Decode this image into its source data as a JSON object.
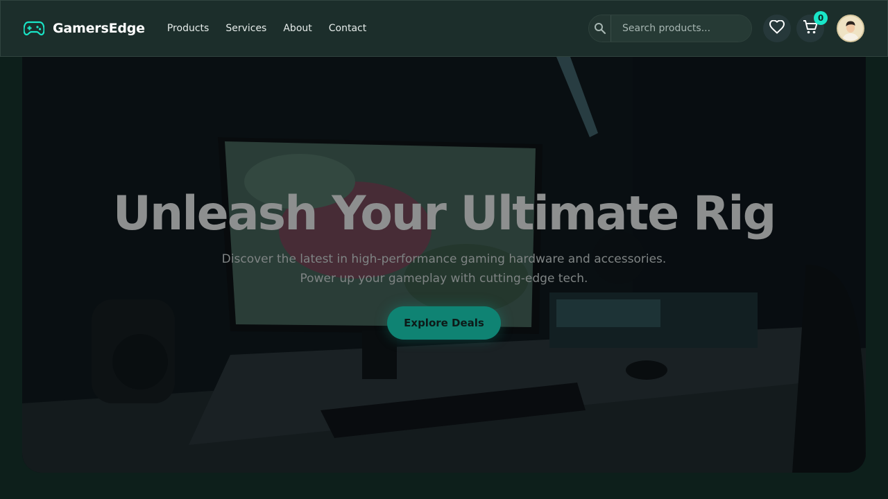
{
  "brand": {
    "name": "GamersEdge",
    "icon": "gamepad-icon",
    "accent": "#19e6c8"
  },
  "nav": [
    {
      "label": "Products"
    },
    {
      "label": "Services"
    },
    {
      "label": "About"
    },
    {
      "label": "Contact"
    }
  ],
  "search": {
    "placeholder": "Search products...",
    "value": ""
  },
  "cart": {
    "count": "0"
  },
  "hero": {
    "title": "Unleash Your Ultimate Rig",
    "subtitle_line1": "Discover the latest in high-performance gaming hardware and accessories.",
    "subtitle_line2": "Power up your gameplay with cutting-edge tech.",
    "cta_label": "Explore Deals"
  },
  "colors": {
    "header_bg": "#1c2e2b",
    "cta_bg": "#0f8373",
    "badge": "#19e6c8"
  }
}
